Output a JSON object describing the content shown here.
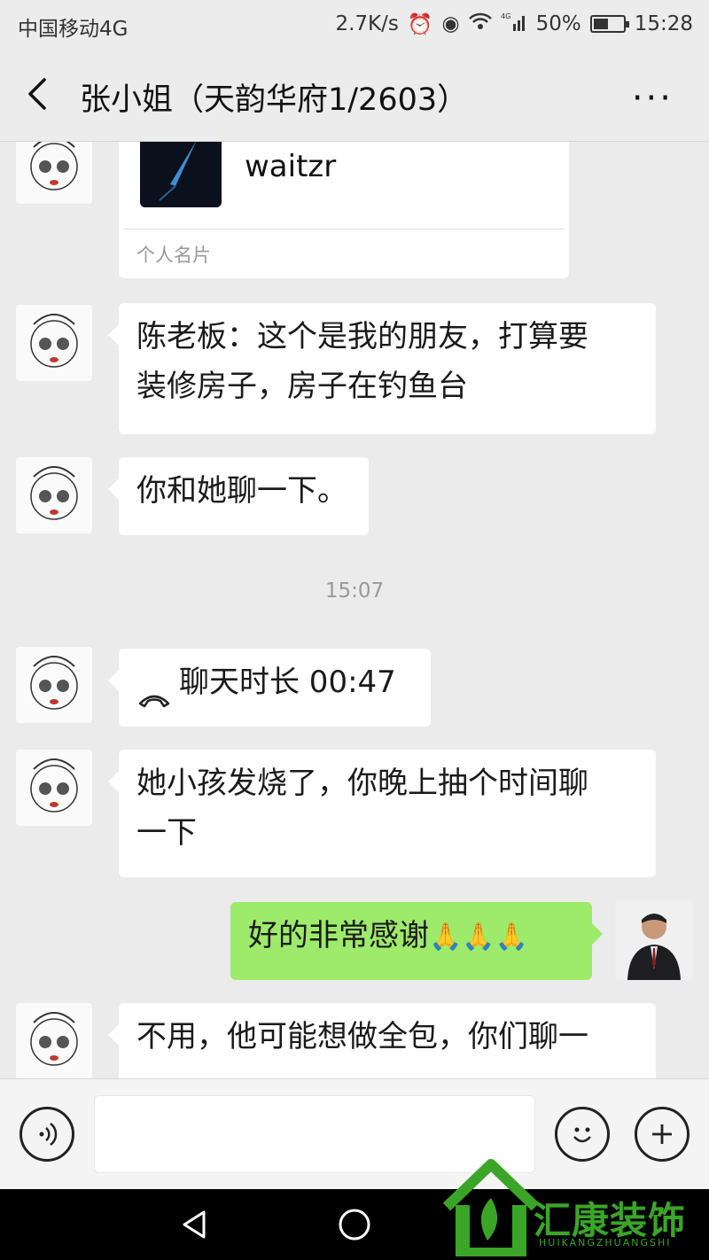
{
  "status": {
    "carrier": "中国移动4G",
    "speed": "2.7K/s",
    "network": "4G",
    "battery": "50%",
    "time": "15:28"
  },
  "header": {
    "title": "张小姐（天韵华府1/2603）",
    "back_icon": "back-arrow-icon",
    "more_icon": "more-icon",
    "more_label": "···"
  },
  "messages": {
    "card": {
      "name": "waitzr",
      "label": "个人名片"
    },
    "m1": {
      "line1": "陈老板：这个是我的朋友，打算要",
      "line2": "装修房子，房子在钓鱼台"
    },
    "m2": {
      "text": "你和她聊一下。"
    },
    "timestamp": "15:07",
    "call": {
      "text": "聊天时长 00:47"
    },
    "m3": {
      "line1": "她小孩发烧了，你晚上抽个时间聊",
      "line2": "一下"
    },
    "mine": {
      "text": "好的非常感谢",
      "emoji": "🙏🙏🙏"
    },
    "m4": {
      "text": "不用，他可能想做全包，你们聊一"
    }
  },
  "watermark": {
    "brand": "汇康装饰",
    "sub": "HUIKANGZHUANGSHI"
  },
  "colors": {
    "sent_bubble": "#9eea6a",
    "received_bubble": "#ffffff",
    "background": "#ebebeb",
    "watermark": "#3aa526"
  }
}
